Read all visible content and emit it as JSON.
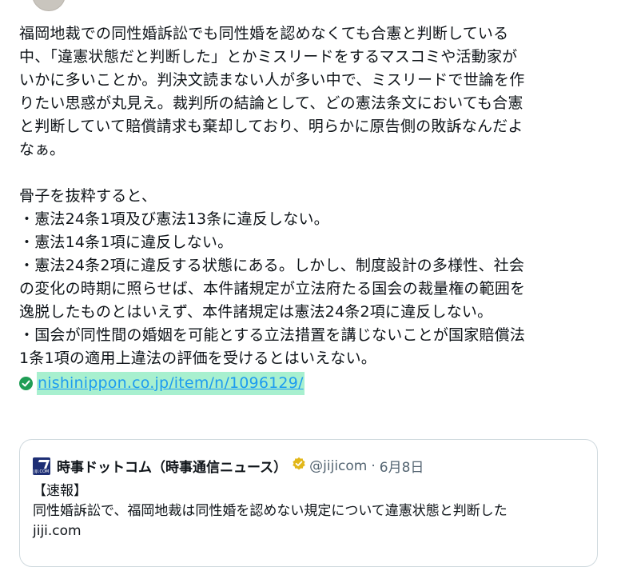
{
  "tweet": {
    "lines": [
      "福岡地裁での同性婚訴訟でも同性婚を認めなくても合憲と判断している",
      "中、「違憲状態だと判断した」とかミスリードをするマスコミや活動家が",
      "いかに多いことか。判決文読まない人が多い中で、ミスリードで世論を作",
      "りたい思惑が丸見え。裁判所の結論として、どの憲法条文においても合憲",
      "と判断していて賠償請求も棄却しており、明らかに原告側の敗訴なんだよ",
      "なぁ。",
      "",
      "骨子を抜粋すると、",
      "・憲法24条1項及び憲法13条に違反しない。",
      "・憲法14条1項に違反しない。",
      "・憲法24条2項に違反する状態にある。しかし、制度設計の多様性、社会",
      "の変化の時期に照らせば、本件諸規定が立法府たる国会の裁量権の範囲を",
      "逸脱したものとはいえず、本件諸規定は憲法24条2項に違反しない。",
      "・国会が同性間の婚姻を可能とする立法措置を講じないことが国家賠償法",
      "1条1項の適用上違法の評価を受けるとはいえない。"
    ],
    "link_text": "nishinippon.co.jp/item/n/1096129/"
  },
  "quote": {
    "logo_text": "JIJI.COM",
    "source_name": "時事ドットコム（時事通信ニュース）",
    "handle": "@jijicom",
    "separator": "·",
    "date": "6月8日",
    "text_lines": [
      "【速報】",
      "同性婚訴訟で、福岡地裁は同性婚を認めない規定について違憲状態と判断した",
      "jiji.com"
    ]
  },
  "colors": {
    "link": "#1d9bf0",
    "link_highlight": "#a8f0cf",
    "check_icon": "#1f9d55",
    "verified_badge": "#e2b719",
    "border": "#cfd9de",
    "muted": "#536471"
  },
  "icons": {
    "link_prefix": "check-circle-icon",
    "verified": "verified-badge-icon",
    "source_logo": "jiji-logo-icon"
  }
}
